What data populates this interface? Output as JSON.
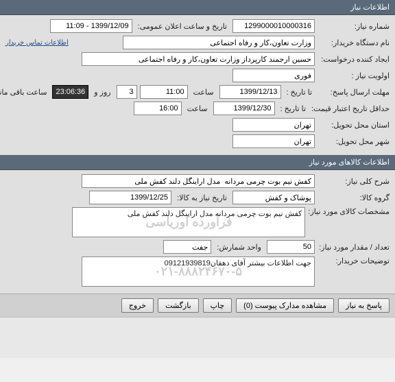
{
  "need_info": {
    "header": "اطلاعات نیاز",
    "need_number_label": "شماره نیاز:",
    "need_number": "1299000010000316",
    "announce_datetime_label": "تاریخ و ساعت اعلان عمومی:",
    "announce_datetime": "1399/12/09 - 11:09",
    "buyer_org_label": "نام دستگاه خریدار:",
    "buyer_org": "وزارت تعاون،کار و رفاه اجتماعی",
    "contact_link": "اطلاعات تماس خریدار",
    "creator_label": "ایجاد کننده درخواست:",
    "creator": "حسین ارجمند کارپرداز وزارت تعاون،کار و رفاه اجتماعی",
    "priority_label": "اولویت نیاز :",
    "priority": "فوری",
    "response_deadline_label": "مهلت ارسال پاسخ:",
    "until_date_label": "تا تاریخ :",
    "until_date": "1399/12/13",
    "time_label": "ساعت",
    "until_time": "11:00",
    "days_count": "3",
    "days_and_label": "روز و",
    "remaining_time": "23:06:36",
    "remaining_label": "ساعت باقی مانده",
    "min_price_history_label": "حداقل تاریخ اعتبار قیمت:",
    "price_until_date": "1399/12/30",
    "price_until_time": "16:00",
    "delivery_province_label": "استان محل تحویل:",
    "delivery_province": "تهران",
    "delivery_city_label": "شهر محل تحویل:",
    "delivery_city": "تهران"
  },
  "goods_info": {
    "header": "اطلاعات کالاهای مورد نیاز",
    "general_desc_label": "شرح کلی نیاز:",
    "general_desc": "کفش نیم بوت چرمی مردانه  مدل اراینگل دلند کفش ملی",
    "goods_group_label": "گروه کالا:",
    "goods_group": "پوشاک و کفش",
    "goods_history_label": "تاریخ نیاز به کالا:",
    "goods_history_date": "1399/12/25",
    "goods_specs_label": "مشخصات کالای مورد نیاز:",
    "goods_specs": "کفش نیم بوت چرمی مردانه  مدل اراینگل دلند کفش ملی",
    "watermark": "فرآورده اوریاسی",
    "qty_label": "تعداد / مقدار مورد نیاز:",
    "qty": "50",
    "unit_label": "واحد شمارش:",
    "unit": "جفت",
    "buyer_notes_label": "توضیحات خریدار:",
    "buyer_notes": "جهت اطلاعات بیشتر آقای دهقان09121939819",
    "phone_watermark": "۰۲۱-۸۸۸۲۴۶۷۰-۵"
  },
  "buttons": {
    "respond": "پاسخ به نیاز",
    "view_docs": "مشاهده مدارک پیوست (0)",
    "print": "چاپ",
    "back": "بازگشت",
    "exit": "خروج"
  }
}
